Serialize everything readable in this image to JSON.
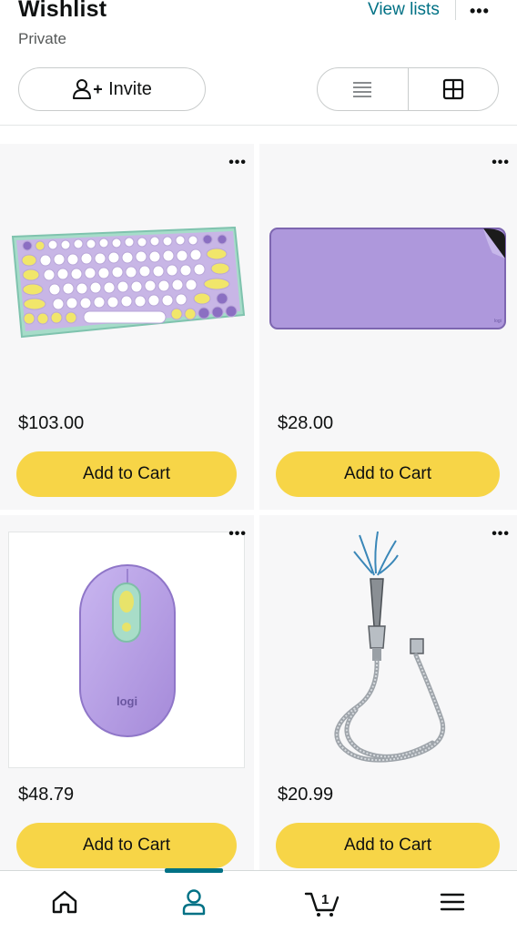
{
  "header": {
    "title": "Wishlist",
    "privacy": "Private",
    "view_lists_label": "View lists",
    "more_label": "•••",
    "invite_label": "Invite"
  },
  "items": [
    {
      "name": "Keyboard",
      "price": "$103.00",
      "cta": "Add to Cart",
      "more": "•••"
    },
    {
      "name": "Desk mat",
      "price": "$28.00",
      "cta": "Add to Cart",
      "more": "•••"
    },
    {
      "name": "Mouse",
      "price": "$48.79",
      "cta": "Add to Cart",
      "more": "•••",
      "image_text": "logi"
    },
    {
      "name": "Shower hose",
      "price": "$20.99",
      "cta": "Add to Cart",
      "more": "•••"
    }
  ],
  "bottom_nav": {
    "items": [
      "home-icon",
      "account-icon",
      "cart-icon",
      "menu-icon"
    ],
    "cart_count": "1",
    "active": "account-icon"
  },
  "colors": {
    "accent": "#007185",
    "button": "#f7d547",
    "card_bg": "#f7f7f8"
  }
}
